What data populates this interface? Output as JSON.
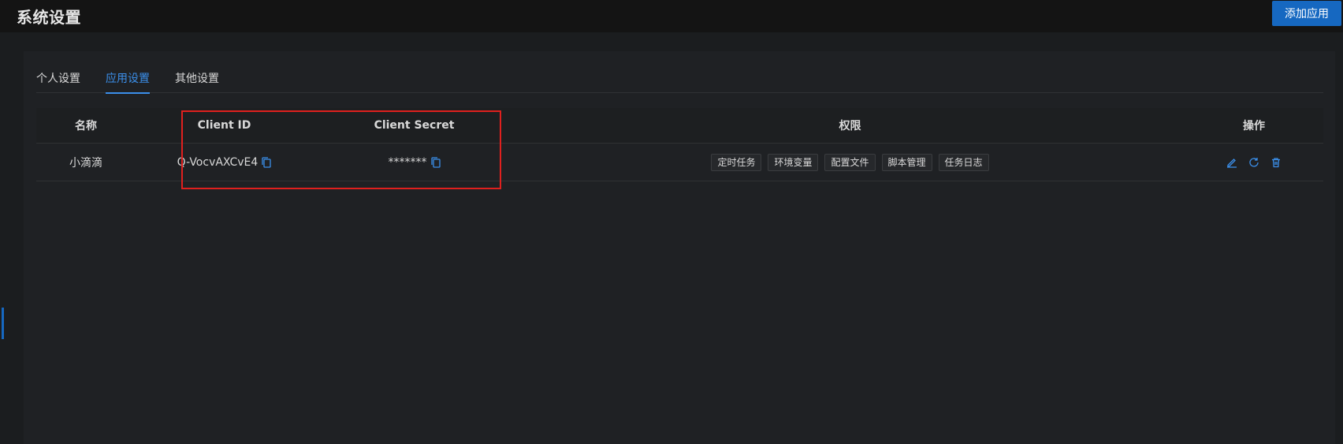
{
  "header": {
    "title": "系统设置",
    "add_button_label": "添加应用"
  },
  "tabs": [
    {
      "label": "个人设置",
      "active": false
    },
    {
      "label": "应用设置",
      "active": true
    },
    {
      "label": "其他设置",
      "active": false
    }
  ],
  "table": {
    "columns": [
      "名称",
      "Client ID",
      "Client Secret",
      "权限",
      "操作"
    ],
    "rows": [
      {
        "name": "小滴滴",
        "client_id": "Q-VocvAXCvE4",
        "client_secret": "*******",
        "permissions": [
          "定时任务",
          "环境变量",
          "配置文件",
          "脚本管理",
          "任务日志"
        ]
      }
    ]
  },
  "colors": {
    "accent": "#3b8fea",
    "primary_button": "#1668c1",
    "highlight_box": "#e0201e"
  },
  "icons": {
    "copy": "copy-icon",
    "edit": "edit-icon",
    "refresh": "refresh-icon",
    "delete": "trash-icon"
  }
}
